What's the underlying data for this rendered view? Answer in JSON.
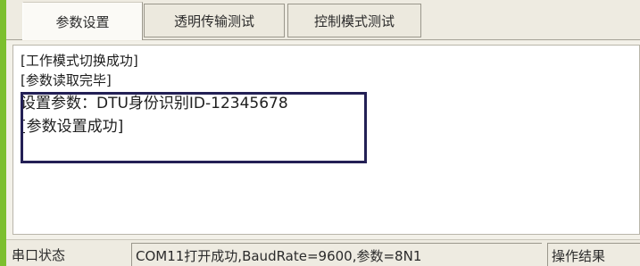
{
  "tabs": [
    {
      "label": "参数设置",
      "active": true
    },
    {
      "label": "透明传输测试",
      "active": false
    },
    {
      "label": "控制模式测试",
      "active": false
    }
  ],
  "log": {
    "lines": [
      "[工作模式切换成功]",
      "[参数读取完毕]",
      "设置参数：DTU身份识别ID-12345678",
      "[参数设置成功]"
    ]
  },
  "statusbar": {
    "port_label": "串口状态",
    "port_status": "COM11打开成功,BaudRate=9600,参数=8N1",
    "result_label": "操作结果"
  },
  "colors": {
    "accent": "#7cbf2f",
    "highlight_border": "#232055"
  }
}
